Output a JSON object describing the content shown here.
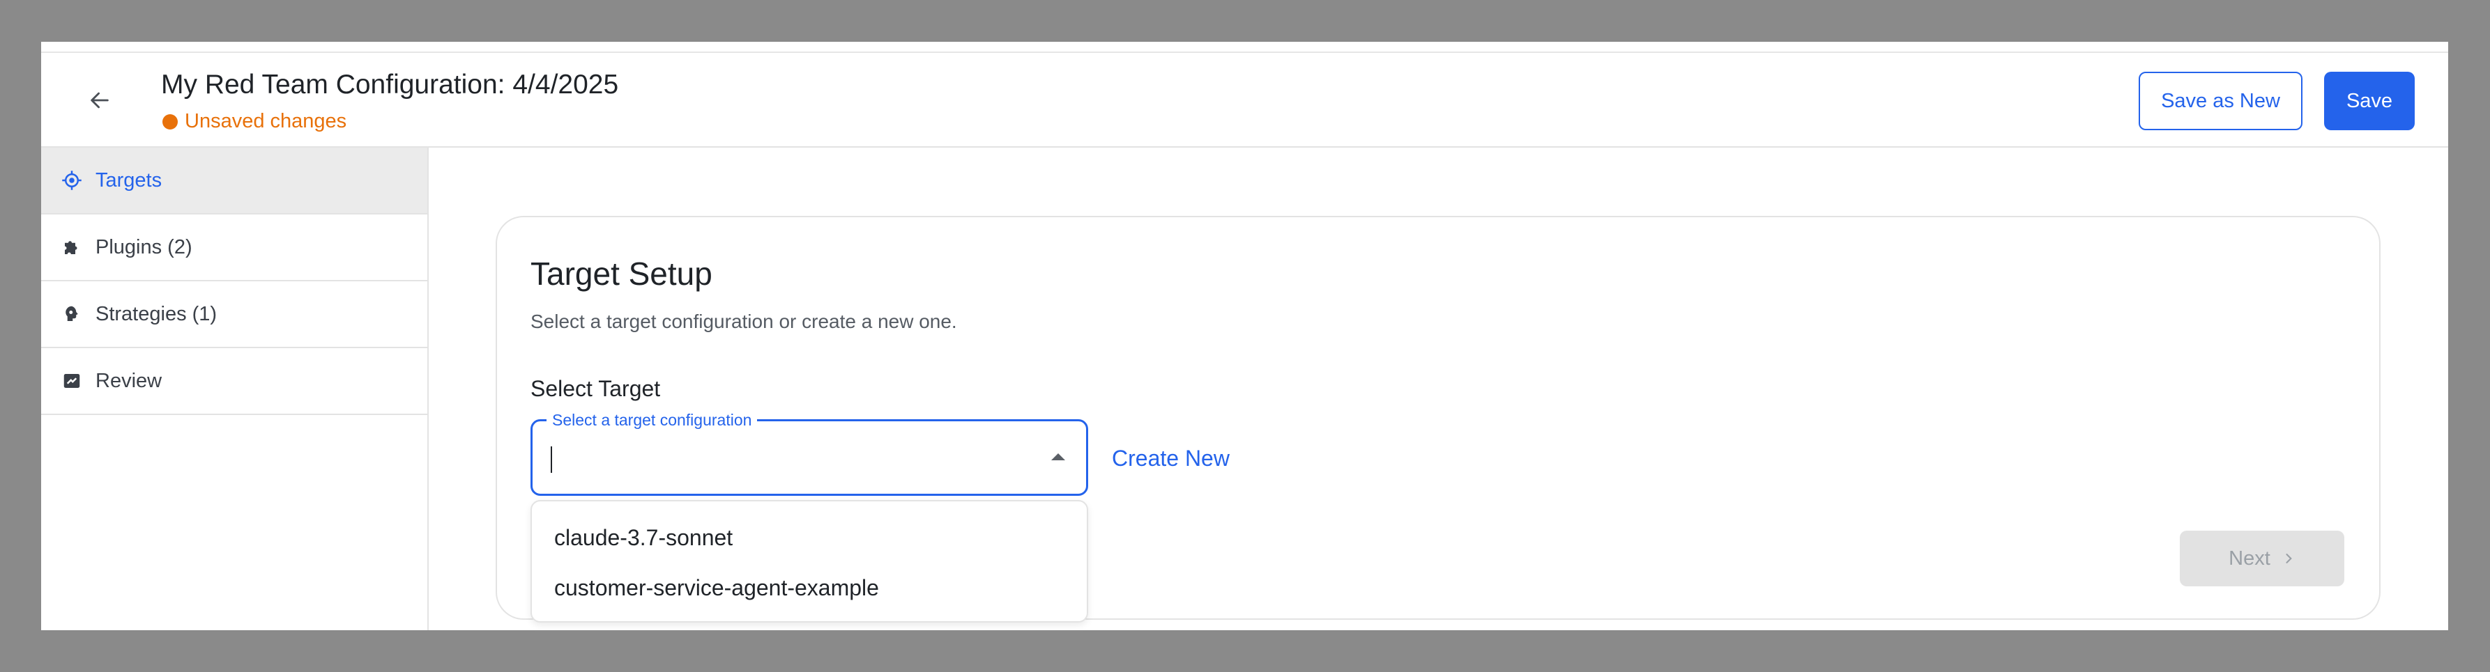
{
  "header": {
    "title": "My Red Team Configuration: 4/4/2025",
    "status": "Unsaved changes",
    "save_as_new_label": "Save as New",
    "save_label": "Save"
  },
  "sidebar": {
    "items": [
      {
        "label": "Targets",
        "icon": "target-icon",
        "active": true
      },
      {
        "label": "Plugins (2)",
        "icon": "puzzle-icon",
        "active": false
      },
      {
        "label": "Strategies (1)",
        "icon": "brain-icon",
        "active": false
      },
      {
        "label": "Review",
        "icon": "review-icon",
        "active": false
      }
    ]
  },
  "main": {
    "title": "Target Setup",
    "subtitle": "Select a target configuration or create a new one.",
    "select_label": "Select Target",
    "select_placeholder": "Select a target configuration",
    "select_value": "",
    "create_new_label": "Create New",
    "options": [
      "claude-3.7-sonnet",
      "customer-service-agent-example"
    ],
    "next_label": "Next"
  },
  "colors": {
    "accent": "#2463eb",
    "warning": "#e8710a",
    "active_bg": "#ebebeb"
  }
}
